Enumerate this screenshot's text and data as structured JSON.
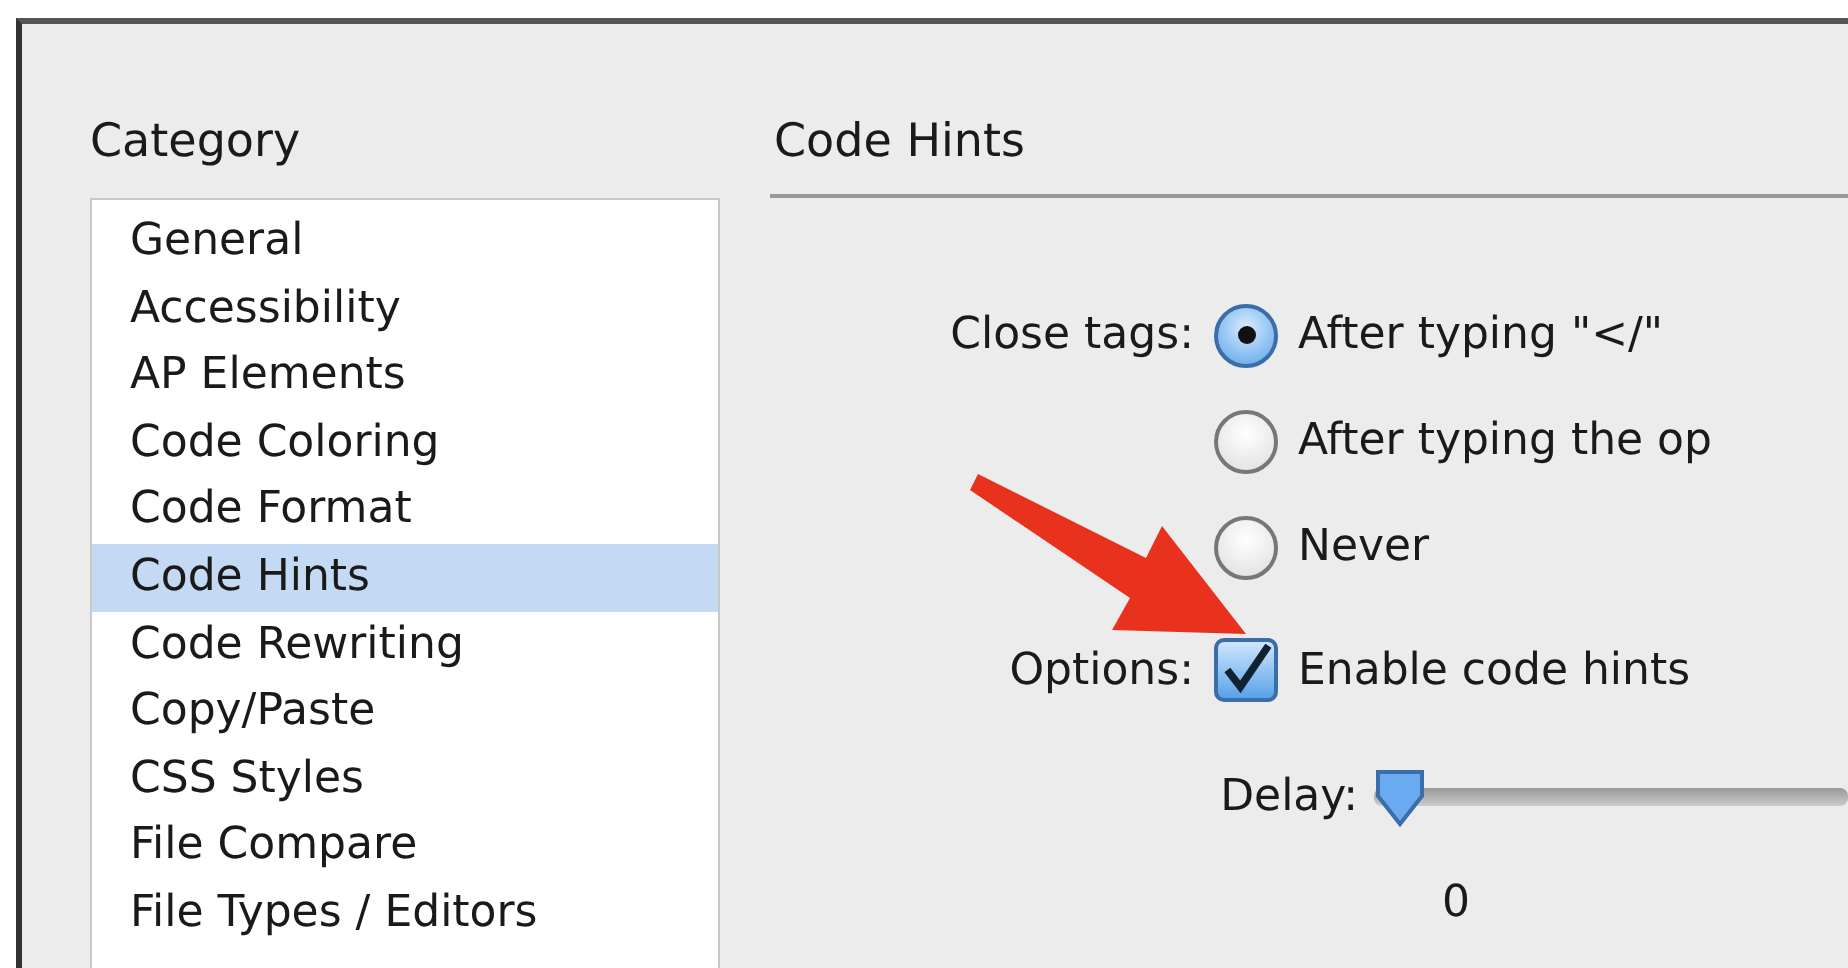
{
  "category": {
    "label": "Category",
    "items": [
      {
        "label": "General",
        "selected": false
      },
      {
        "label": "Accessibility",
        "selected": false
      },
      {
        "label": "AP Elements",
        "selected": false
      },
      {
        "label": "Code Coloring",
        "selected": false
      },
      {
        "label": "Code Format",
        "selected": false
      },
      {
        "label": "Code Hints",
        "selected": true
      },
      {
        "label": "Code Rewriting",
        "selected": false
      },
      {
        "label": "Copy/Paste",
        "selected": false
      },
      {
        "label": "CSS Styles",
        "selected": false
      },
      {
        "label": "File Compare",
        "selected": false
      },
      {
        "label": "File Types / Editors",
        "selected": false
      }
    ]
  },
  "panel": {
    "title": "Code Hints",
    "close_tags": {
      "label": "Close tags:",
      "options": [
        {
          "label": "After typing \"</\"",
          "selected": true
        },
        {
          "label": "After typing the op",
          "selected": false
        },
        {
          "label": "Never",
          "selected": false
        }
      ]
    },
    "options": {
      "label": "Options:",
      "checkboxes": [
        {
          "label": "Enable code hints",
          "checked": true
        }
      ]
    },
    "delay": {
      "label": "Delay:",
      "level": 0,
      "reading": "0"
    }
  }
}
